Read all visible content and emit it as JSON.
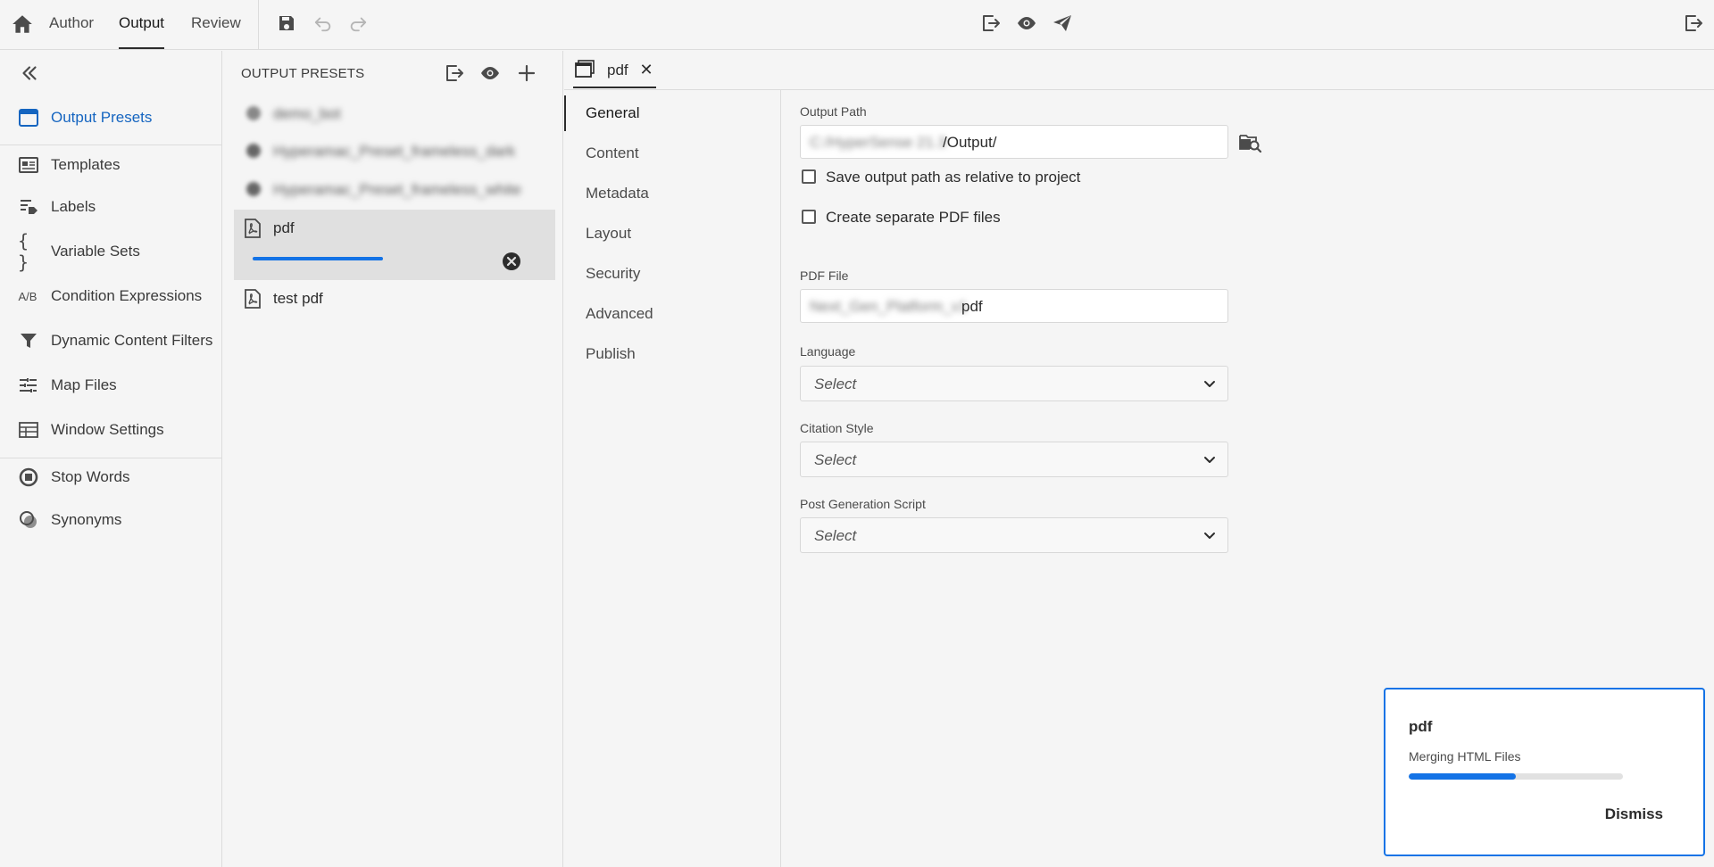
{
  "topbar": {
    "tabs": [
      {
        "label": "Author",
        "active": false
      },
      {
        "label": "Output",
        "active": true
      },
      {
        "label": "Review",
        "active": false
      }
    ],
    "icons": [
      "home-icon",
      "save-icon",
      "undo-icon",
      "redo-icon",
      "export-icon",
      "preview-icon",
      "publish-icon",
      "exit-icon"
    ]
  },
  "leftnav": {
    "items": [
      {
        "label": "Output Presets",
        "icon": "output-presets-icon",
        "active": true
      },
      {
        "label": "Templates",
        "icon": "templates-icon",
        "active": false
      },
      {
        "label": "Labels",
        "icon": "labels-icon",
        "active": false
      },
      {
        "label": "Variable Sets",
        "icon": "braces-icon",
        "active": false
      },
      {
        "label": "Condition Expressions",
        "icon": "ab-icon",
        "icon_text": "A/B",
        "active": false
      },
      {
        "label": "Dynamic Content Filters",
        "icon": "filter-icon",
        "active": false
      },
      {
        "label": "Map Files",
        "icon": "map-files-icon",
        "active": false
      },
      {
        "label": "Window Settings",
        "icon": "window-settings-icon",
        "active": false
      },
      {
        "label": "Stop Words",
        "icon": "stop-icon",
        "active": false
      },
      {
        "label": "Synonyms",
        "icon": "synonyms-icon",
        "active": false
      }
    ]
  },
  "presets": {
    "heading": "OUTPUT PRESETS",
    "items": [
      {
        "label": "demo_bot",
        "blurred": true,
        "icon": "preset-icon"
      },
      {
        "label": "Hyperamac_Preset_frameless_dark",
        "blurred": true,
        "icon": "preset-icon"
      },
      {
        "label": "Hyperamac_Preset_frameless_white",
        "blurred": true,
        "icon": "preset-icon"
      },
      {
        "label": "pdf",
        "blurred": false,
        "selected": true,
        "icon": "pdf-file-icon"
      },
      {
        "label": "test pdf",
        "blurred": false,
        "icon": "pdf-file-icon"
      }
    ]
  },
  "editor": {
    "tab": {
      "label": "pdf",
      "close": "✕"
    },
    "subnav": [
      "General",
      "Content",
      "Metadata",
      "Layout",
      "Security",
      "Advanced",
      "Publish"
    ],
    "active_subnav": "General",
    "form": {
      "output_path_label": "Output Path",
      "output_path_hidden": "C:/HyperSense 21.3",
      "output_path_value": "/Output/",
      "checkbox_relative": "Save output path as relative to project",
      "checkbox_separate": "Create separate PDF files",
      "pdf_file_label": "PDF File",
      "pdf_file_hidden": "Next_Gen_Platform_v1",
      "pdf_file_value": "pdf",
      "language_label": "Language",
      "language_value": "Select",
      "citation_label": "Citation Style",
      "citation_value": "Select",
      "script_label": "Post Generation Script",
      "script_value": "Select"
    }
  },
  "toast": {
    "title": "pdf",
    "message": "Merging HTML Files",
    "progress": 0.5,
    "dismiss": "Dismiss"
  },
  "colors": {
    "accent": "#1473e6",
    "active_nav": "#1565c0",
    "background": "#f5f5f5"
  }
}
